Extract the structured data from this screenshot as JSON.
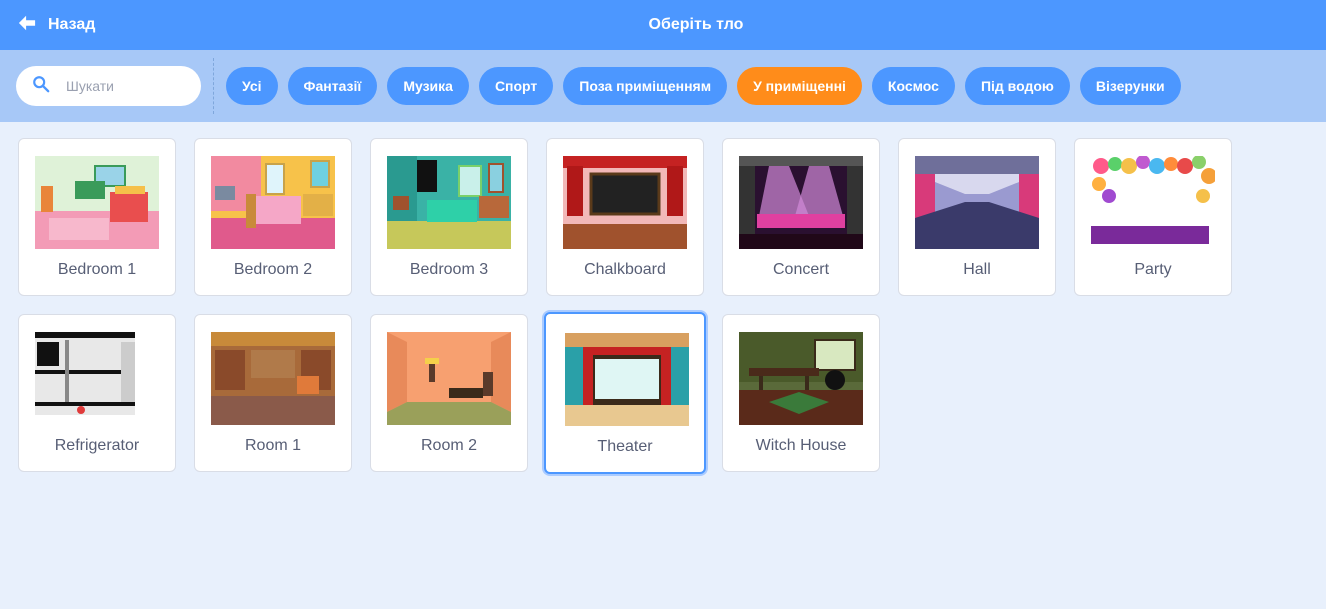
{
  "header": {
    "back_label": "Назад",
    "title": "Оберіть тло"
  },
  "search": {
    "placeholder": "Шукати"
  },
  "tags": [
    {
      "label": "Усі",
      "active": false
    },
    {
      "label": "Фантазії",
      "active": false
    },
    {
      "label": "Музика",
      "active": false
    },
    {
      "label": "Спорт",
      "active": false
    },
    {
      "label": "Поза приміщенням",
      "active": false
    },
    {
      "label": "У приміщенні",
      "active": true
    },
    {
      "label": "Космос",
      "active": false
    },
    {
      "label": "Під водою",
      "active": false
    },
    {
      "label": "Візерунки",
      "active": false
    }
  ],
  "backdrops": [
    {
      "name": "Bedroom 1",
      "selected": false
    },
    {
      "name": "Bedroom 2",
      "selected": false
    },
    {
      "name": "Bedroom 3",
      "selected": false
    },
    {
      "name": "Chalkboard",
      "selected": false
    },
    {
      "name": "Concert",
      "selected": false
    },
    {
      "name": "Hall",
      "selected": false
    },
    {
      "name": "Party",
      "selected": false
    },
    {
      "name": "Refrigerator",
      "selected": false
    },
    {
      "name": "Room 1",
      "selected": false
    },
    {
      "name": "Room 2",
      "selected": false
    },
    {
      "name": "Theater",
      "selected": true
    },
    {
      "name": "Witch House",
      "selected": false
    }
  ],
  "colors": {
    "header": "#4c97ff",
    "filter_bar": "#a7c8f7",
    "tag": "#4c97ff",
    "tag_active": "#ff8c1a",
    "background": "#e8f0fc"
  }
}
